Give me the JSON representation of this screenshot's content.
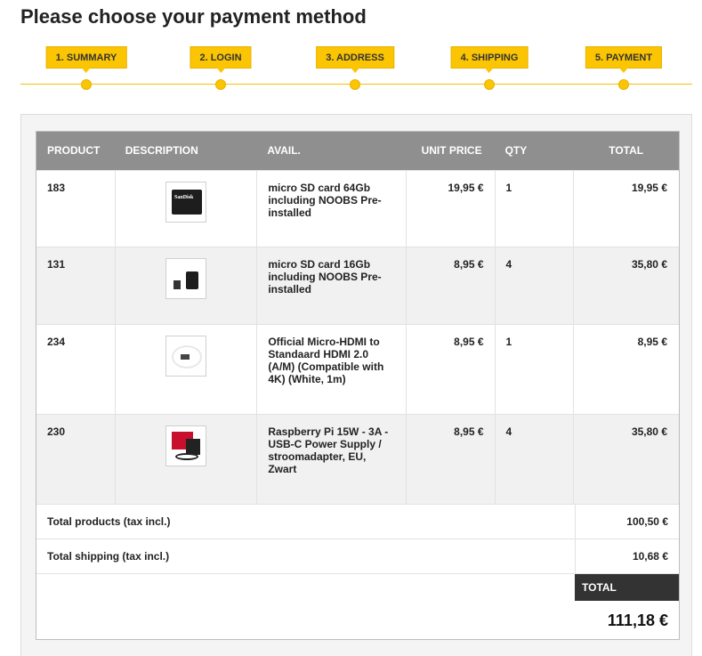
{
  "page_title": "Please choose your payment method",
  "steps": [
    {
      "label": "1. SUMMARY"
    },
    {
      "label": "2. LOGIN"
    },
    {
      "label": "3. ADDRESS"
    },
    {
      "label": "4. SHIPPING"
    },
    {
      "label": "5. PAYMENT"
    }
  ],
  "cart": {
    "headers": {
      "product": "PRODUCT",
      "description": "DESCRIPTION",
      "avail": "AVAIL.",
      "unit_price": "UNIT PRICE",
      "qty": "QTY",
      "total": "TOTAL"
    },
    "rows": [
      {
        "product": "183",
        "image": "microsd-64gb-thumbnail",
        "avail": "micro SD card 64Gb including NOOBS Pre-installed",
        "unit_price": "19,95 €",
        "qty": "1",
        "total": "19,95 €"
      },
      {
        "product": "131",
        "image": "microsd-16gb-thumbnail",
        "avail": "micro SD card 16Gb including NOOBS Pre-installed",
        "unit_price": "8,95 €",
        "qty": "4",
        "total": "35,80 €"
      },
      {
        "product": "234",
        "image": "micro-hdmi-cable-thumbnail",
        "avail": "Official Micro-HDMI to Standaard HDMI 2.0 (A/M) (Compatible with 4K) (White, 1m)",
        "unit_price": "8,95 €",
        "qty": "1",
        "total": "8,95 €"
      },
      {
        "product": "230",
        "image": "power-supply-thumbnail",
        "avail": "Raspberry Pi 15W - 3A - USB-C Power Supply / stroomadapter, EU, Zwart",
        "unit_price": "8,95 €",
        "qty": "4",
        "total": "35,80 €"
      }
    ],
    "summary": {
      "total_products_label": "Total products (tax incl.)",
      "total_products_value": "100,50 €",
      "total_shipping_label": "Total shipping (tax incl.)",
      "total_shipping_value": "10,68 €",
      "total_label": "TOTAL",
      "total_value": "111,18 €"
    }
  },
  "colors": {
    "accent": "#fbc503",
    "header_bg": "#8f8f8f",
    "total_bg": "#333333"
  }
}
